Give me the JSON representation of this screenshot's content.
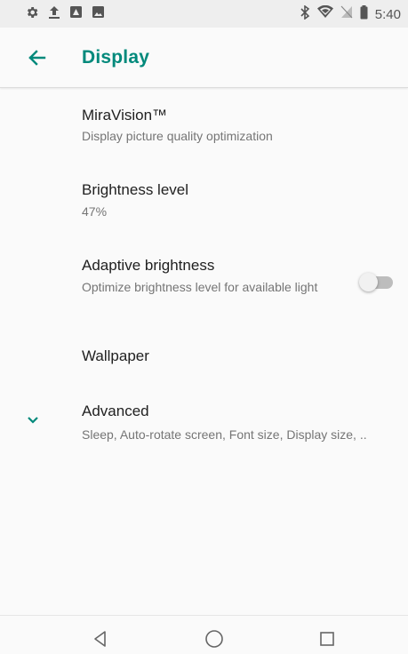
{
  "status_bar": {
    "time": "5:40",
    "left_icons": [
      "settings-icon",
      "upload-icon",
      "app-icon",
      "image-icon"
    ],
    "right_icons": [
      "bluetooth-icon",
      "wifi-icon",
      "no-sim-icon",
      "battery-icon"
    ]
  },
  "app_bar": {
    "title": "Display",
    "back_icon": "arrow-back-icon",
    "accent_color": "#00897b"
  },
  "settings": {
    "miravision": {
      "title": "MiraVision™",
      "summary": "Display picture quality optimization"
    },
    "brightness": {
      "title": "Brightness level",
      "summary": "47%"
    },
    "adaptive": {
      "title": "Adaptive brightness",
      "summary": "Optimize brightness level for available light",
      "enabled": false
    },
    "wallpaper": {
      "title": "Wallpaper"
    },
    "advanced": {
      "title": "Advanced",
      "summary": "Sleep, Auto-rotate screen, Font size, Display size, ..",
      "icon": "chevron-down-icon"
    }
  },
  "nav_bar": {
    "buttons": [
      "back-triangle-icon",
      "home-circle-icon",
      "recents-square-icon"
    ]
  }
}
